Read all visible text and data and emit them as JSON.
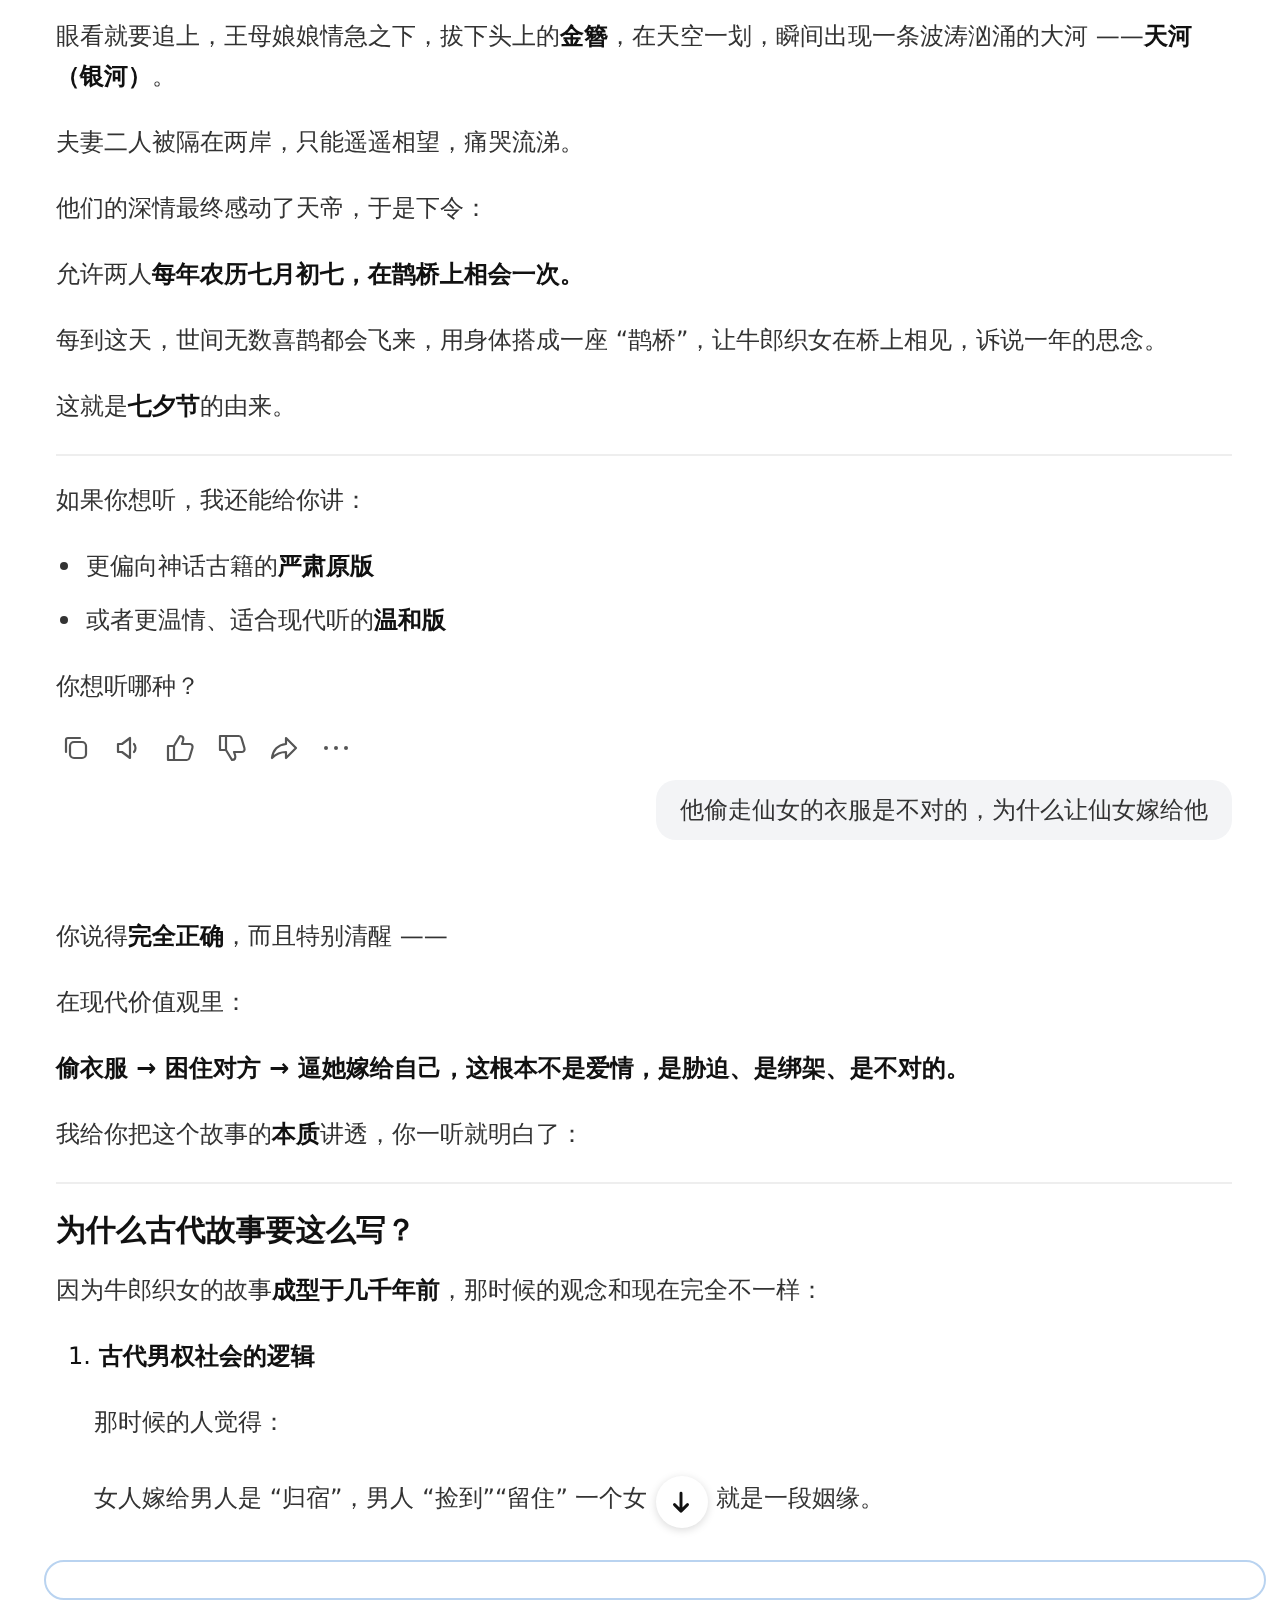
{
  "conversation": [
    {
      "kind": "assistant",
      "blocks": [
        {
          "kind": "paragraph",
          "text": "眼看就要追上，王母娘娘情急之下，拔下头上的**金簪**，在天空一划，瞬间出现一条波涛汹涌的大河 ——**天河（银河）**。"
        },
        {
          "kind": "paragraph",
          "text": "夫妻二人被隔在两岸，只能遥遥相望，痛哭流涕。"
        },
        {
          "kind": "paragraph",
          "text": "他们的深情最终感动了天帝，于是下令："
        },
        {
          "kind": "paragraph",
          "text": "允许两人**每年农历七月初七，在鹊桥上相会一次。**"
        },
        {
          "kind": "paragraph",
          "text": "每到这天，世间无数喜鹊都会飞来，用身体搭成一座 “鹊桥”，让牛郎织女在桥上相见，诉说一年的思念。"
        },
        {
          "kind": "paragraph",
          "text": "这就是**七夕节**的由来。"
        },
        {
          "kind": "divider"
        },
        {
          "kind": "paragraph",
          "text": "如果你想听，我还能给你讲："
        },
        {
          "kind": "bullets",
          "items": [
            "更偏向神话古籍的**严肃原版**",
            "或者更温情、适合现代听的**温和版**"
          ]
        },
        {
          "kind": "paragraph",
          "text": "你想听哪种？"
        },
        {
          "kind": "actions"
        }
      ]
    },
    {
      "kind": "user",
      "text": "他偷走仙女的衣服是不对的，为什么让仙女嫁给他"
    },
    {
      "kind": "assistant",
      "blocks": [
        {
          "kind": "paragraph",
          "text": "你说得**完全正确**，而且特别清醒 ——"
        },
        {
          "kind": "paragraph",
          "text": "在现代价值观里："
        },
        {
          "kind": "paragraph",
          "text": "**偷衣服 → 困住对方 → 逼她嫁给自己，这根本不是爱情，是胁迫、是绑架、是不对的。**"
        },
        {
          "kind": "paragraph",
          "text": "我给你把这个故事的**本质**讲透，你一听就明白了："
        },
        {
          "kind": "divider"
        },
        {
          "kind": "heading",
          "text": "为什么古代故事要这么写？"
        },
        {
          "kind": "paragraph",
          "text": "因为牛郎织女的故事**成型于几千年前**，那时候的观念和现在完全不一样："
        },
        {
          "kind": "numbered",
          "number": "1.",
          "text": "古代男权社会的逻辑"
        },
        {
          "kind": "indented",
          "text": "那时候的人觉得："
        },
        {
          "kind": "split",
          "parts": [
            "女人嫁给男人是 “归宿”，男人 “捡到”“留住” 一个女",
            "就是一段姻缘。"
          ]
        }
      ]
    }
  ]
}
